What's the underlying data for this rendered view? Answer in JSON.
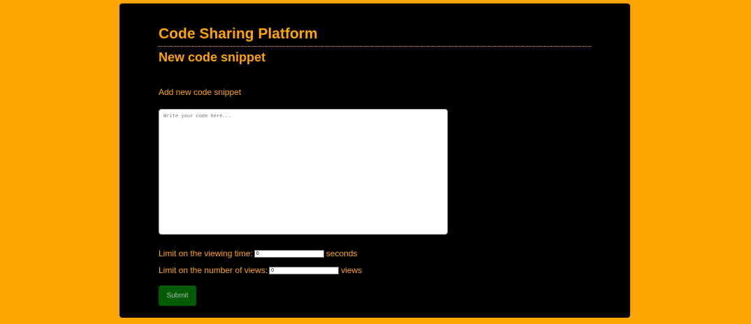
{
  "header": {
    "app_title": "Code Sharing Platform",
    "page_title": "New code snippet"
  },
  "form": {
    "label": "Add new code snippet",
    "code": {
      "value": "",
      "placeholder": "Write your code here..."
    },
    "time_limit": {
      "label": "Limit on the viewing time:",
      "value": "0",
      "unit": "seconds"
    },
    "views_limit": {
      "label": "Limit on the number of views:",
      "value": "0",
      "unit": "views"
    },
    "submit_label": "Submit"
  },
  "colors": {
    "page_background": "#ffa500",
    "panel_background": "#000000",
    "accent": "#ffa500",
    "submit_background": "#005c00"
  }
}
